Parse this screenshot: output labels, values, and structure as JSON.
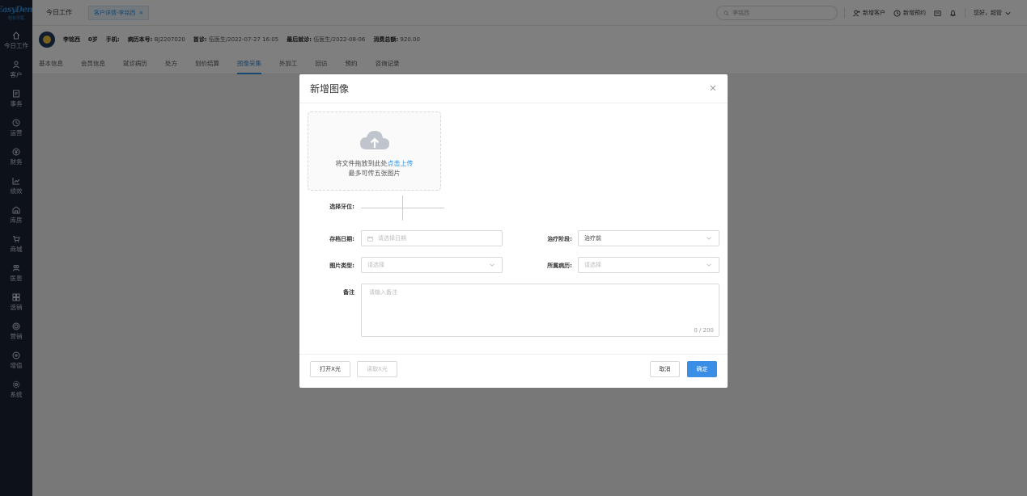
{
  "app": {
    "logo": "EasyDent",
    "logo_sub": "轻松牙医"
  },
  "sidebar": {
    "items": [
      {
        "label": "今日工作",
        "icon": "home-icon"
      },
      {
        "label": "客户",
        "icon": "user-icon"
      },
      {
        "label": "事务",
        "icon": "task-icon"
      },
      {
        "label": "运营",
        "icon": "clock-icon"
      },
      {
        "label": "财务",
        "icon": "money-icon"
      },
      {
        "label": "绩效",
        "icon": "chart-icon"
      },
      {
        "label": "库房",
        "icon": "warehouse-icon"
      },
      {
        "label": "商城",
        "icon": "cart-icon"
      },
      {
        "label": "医患",
        "icon": "people-icon"
      },
      {
        "label": "选销",
        "icon": "grid-icon"
      },
      {
        "label": "营销",
        "icon": "target-icon"
      },
      {
        "label": "增值",
        "icon": "plus-circle-icon"
      },
      {
        "label": "系统",
        "icon": "gear-icon"
      }
    ]
  },
  "topbar": {
    "today_tab": "今日工作",
    "active_tab": "客户详情-李铭西",
    "active_tab_close": "×",
    "search_value": "李铭西",
    "add_customer": "新增客户",
    "add_appointment": "新增预约",
    "greeting": "您好，超管"
  },
  "patient": {
    "name": "李铭西",
    "age": "0岁",
    "phone_label": "手机:",
    "phone_value": "",
    "record_label": "病历本号:",
    "record_value": "BJ2207020",
    "first_visit_label": "首诊:",
    "first_visit_value": "伍医生/2022-07-27 16:05",
    "last_visit_label": "最后就诊:",
    "last_visit_value": "伍医生/2022-08-06",
    "total_label": "消费总额:",
    "total_value": "920.00"
  },
  "detail_tabs": [
    "基本信息",
    "会员信息",
    "就诊病历",
    "处方",
    "划价结算",
    "图像采集",
    "外加工",
    "回访",
    "预约",
    "咨询记录"
  ],
  "detail_tab_active_index": 5,
  "modal": {
    "title": "新增图像",
    "upload_prefix": "将文件拖放到此处",
    "upload_link": "点击上传",
    "upload_hint": "最多可传五张图片",
    "tooth_label": "选择牙位:",
    "archive_date_label": "存档日期:",
    "archive_date_placeholder": "请选择日期",
    "stage_label": "治疗阶段:",
    "stage_value": "治疗前",
    "image_type_label": "图片类型:",
    "image_type_placeholder": "请选择",
    "record_label": "所属病历:",
    "record_placeholder": "请选择",
    "note_label": "备注",
    "note_placeholder": "请输入备注",
    "note_counter": "0 / 200",
    "open_xray": "打开X光",
    "read_xray": "读取X光",
    "cancel": "取消",
    "confirm": "确定"
  },
  "colors": {
    "primary": "#3a8ee6",
    "sidebar_bg": "#1a2332",
    "link": "#2f8fe0"
  }
}
